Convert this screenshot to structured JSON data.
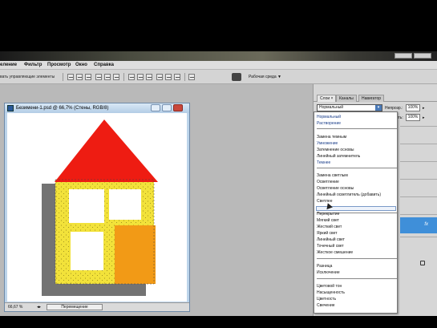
{
  "menubar": {
    "items": [
      "еление",
      "Фильтр",
      "Просмотр",
      "Окно",
      "Справка"
    ]
  },
  "options_bar": {
    "show_controls_label": "вать управляющие элементы",
    "workspace_label": "Рабочая среда ▼"
  },
  "document": {
    "title": "Безимени-1.psd @ 66,7% (Стены, RGB/8)",
    "zoom": "66,67 %",
    "status_tool": "Перемещение"
  },
  "layers_panel": {
    "tabs": [
      "Слои ×",
      "Каналы",
      "Навигатор"
    ],
    "blend_mode_value": "Нормальный",
    "opacity_label": "Непрозр.:",
    "opacity_value": "100%",
    "fill_label": "Залить:",
    "fill_value": "100%"
  },
  "blend_menu": {
    "items": [
      "Нормальный",
      "Растворение",
      "Замена темным",
      "Умножение",
      "Затемнение основы",
      "Линейный затемнитель",
      "Темнее",
      "Замена светлым",
      "Осветление",
      "Осветление основы",
      "Линейный осветлитель (добавить)",
      "Светлее",
      "Перекрытие",
      "Мягкий свет",
      "Жесткий свет",
      "Яркий свет",
      "Линейный свет",
      "Точечный свет",
      "Жесткое смешение",
      "Разница",
      "Исключение",
      "Цветовой тон",
      "Насыщенность",
      "Цветность",
      "Свечение"
    ]
  },
  "colors": {
    "roof": "#ee1c12",
    "walls": "#f2e23a",
    "door": "#f29a16",
    "selection": "#3f8fd9"
  }
}
